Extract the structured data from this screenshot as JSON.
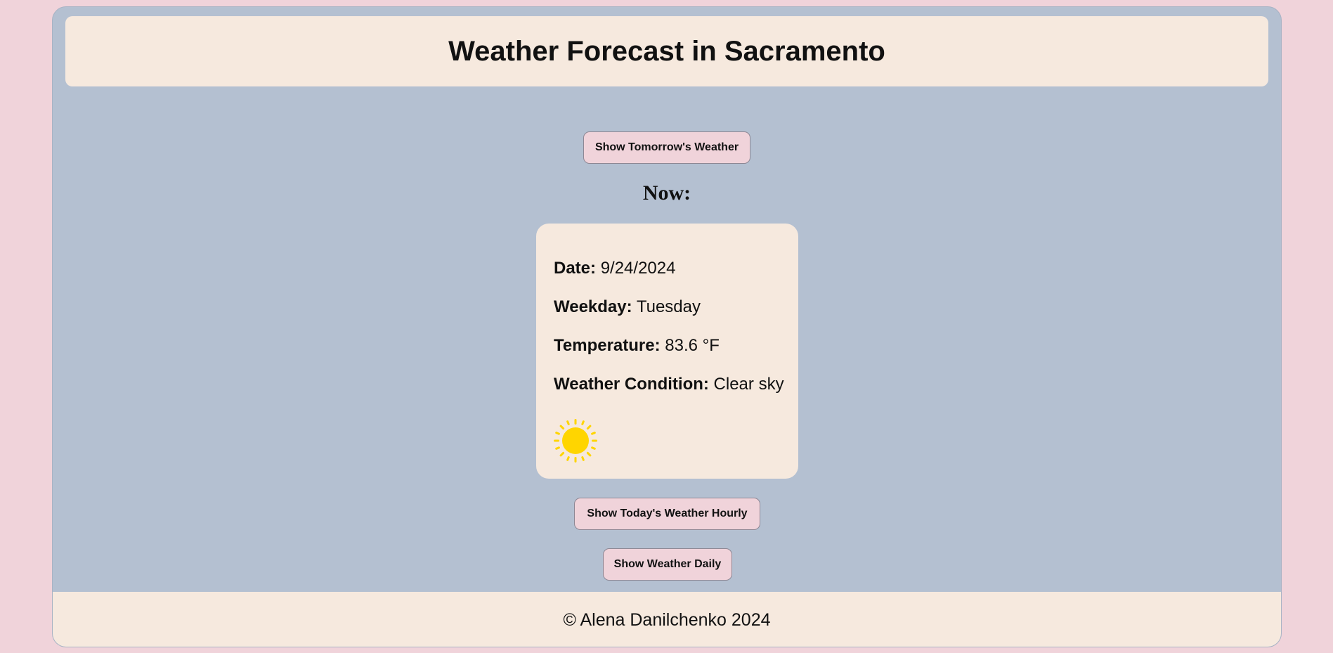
{
  "header": {
    "title": "Weather Forecast in Sacramento"
  },
  "buttons": {
    "tomorrow_label": "Show Tomorrow's Weather",
    "hourly_label": "Show Today's Weather Hourly",
    "daily_label": "Show Weather Daily"
  },
  "now": {
    "heading": "Now:",
    "date_label": "Date:",
    "date_value": "9/24/2024",
    "weekday_label": "Weekday:",
    "weekday_value": "Tuesday",
    "temperature_label": "Temperature:",
    "temperature_value": "83.6 °F",
    "condition_label": "Weather Condition:",
    "condition_value": "Clear sky",
    "icon": "sun-icon"
  },
  "footer": {
    "copyright": "© Alena Danilchenko 2024"
  },
  "colors": {
    "page_background": "#f0d3da",
    "app_background": "#b4c0d1",
    "panel_background": "#f6e9de",
    "button_background": "#f0d3da",
    "sun": "#ffd500"
  }
}
